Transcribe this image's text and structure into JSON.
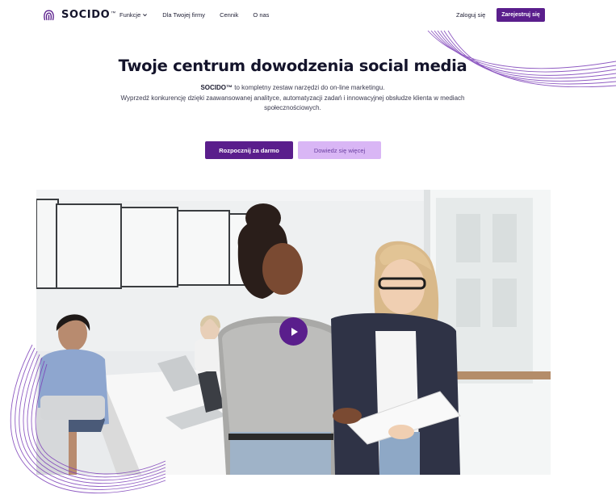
{
  "brand": {
    "name": "SOCIDO",
    "tm": "™",
    "accent": "#5a1e8c",
    "accent_light": "#d9b6f5",
    "logo_icon": "fingerprint-icon"
  },
  "nav": {
    "items": [
      {
        "label": "Funkcje",
        "has_dropdown": true
      },
      {
        "label": "Dla Twojej firmy"
      },
      {
        "label": "Cennik"
      },
      {
        "label": "O nas"
      }
    ],
    "login_label": "Zaloguj się",
    "register_label": "Zarejestruj się"
  },
  "hero": {
    "title": "Twoje centrum dowodzenia social media",
    "subtitle_brand": "SOCIDO™",
    "subtitle_line1_rest": " to kompletny zestaw narzędzi do on-line marketingu.",
    "subtitle_line2": "Wyprzedź konkurencję dzięki zaawansowanej analityce, automatyzacji zadań i innowacyjnej obsłudze klienta w mediach społecznościowych.",
    "cta_primary": "Rozpocznij za darmo",
    "cta_secondary": "Dowiedz się więcej"
  },
  "video": {
    "play_icon": "play-icon",
    "scene": "office-photo"
  }
}
